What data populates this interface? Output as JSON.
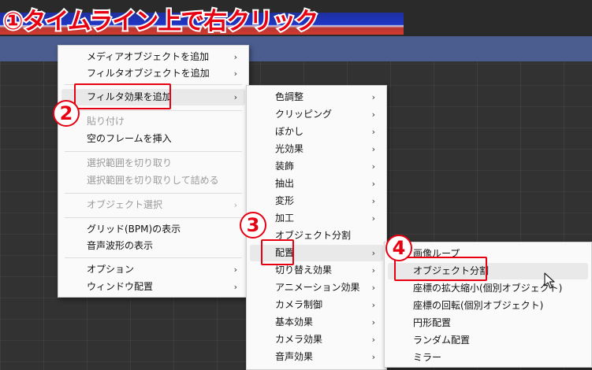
{
  "annotation": {
    "title": "①タイムライン上で右クリック",
    "step2": "2",
    "step3": "3",
    "step4": "4"
  },
  "context_menu": {
    "items": [
      {
        "label": "メディアオブジェクトを追加",
        "arrow": "›"
      },
      {
        "label": "フィルタオブジェクトを追加",
        "arrow": "›"
      },
      {
        "label": "フィルタ効果を追加",
        "arrow": "›"
      },
      {
        "label": "貼り付け"
      },
      {
        "label": "空のフレームを挿入"
      },
      {
        "label": "選択範囲を切り取り"
      },
      {
        "label": "選択範囲を切り取りして詰める"
      },
      {
        "label": "オブジェクト選択",
        "arrow": "›"
      },
      {
        "label": "グリッド(BPM)の表示"
      },
      {
        "label": "音声波形の表示"
      },
      {
        "label": "オプション",
        "arrow": "›"
      },
      {
        "label": "ウィンドウ配置",
        "arrow": "›"
      }
    ]
  },
  "filter_menu": {
    "items": [
      {
        "label": "色調整",
        "arrow": "›"
      },
      {
        "label": "クリッピング",
        "arrow": "›"
      },
      {
        "label": "ぼかし",
        "arrow": "›"
      },
      {
        "label": "光効果",
        "arrow": "›"
      },
      {
        "label": "装飾",
        "arrow": "›"
      },
      {
        "label": "抽出",
        "arrow": "›"
      },
      {
        "label": "変形",
        "arrow": "›"
      },
      {
        "label": "加工",
        "arrow": "›"
      },
      {
        "label": "オブジェクト分割",
        "arrow": ""
      },
      {
        "label": "配置",
        "arrow": "›"
      },
      {
        "label": "切り替え効果",
        "arrow": "›"
      },
      {
        "label": "アニメーション効果",
        "arrow": "›"
      },
      {
        "label": "カメラ制御",
        "arrow": "›"
      },
      {
        "label": "基本効果",
        "arrow": "›"
      },
      {
        "label": "カメラ効果",
        "arrow": "›"
      },
      {
        "label": "音声効果",
        "arrow": "›"
      }
    ]
  },
  "placement_menu": {
    "items": [
      {
        "label": "画像ループ"
      },
      {
        "label": "オブジェクト分割"
      },
      {
        "label": "座標の拡大縮小(個別オブジェクト)"
      },
      {
        "label": "座標の回転(個別オブジェクト)"
      },
      {
        "label": "円形配置"
      },
      {
        "label": "ランダム配置"
      },
      {
        "label": "ミラー"
      }
    ]
  }
}
